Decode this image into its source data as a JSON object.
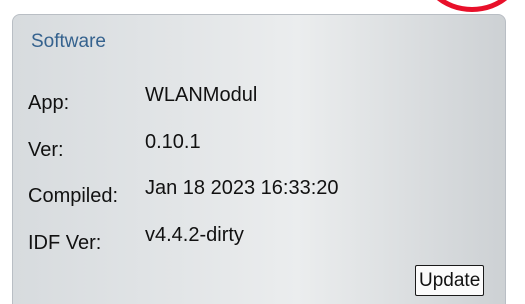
{
  "software": {
    "title": "Software",
    "rows": [
      {
        "label": "App:",
        "value": "WLANModul"
      },
      {
        "label": "Ver:",
        "value": "0.10.1"
      },
      {
        "label": "Compiled:",
        "value": "Jan 18 2023 16:33:20"
      },
      {
        "label": "IDF Ver:",
        "value": "v4.4.2-dirty"
      }
    ],
    "update_label": "Update"
  },
  "colors": {
    "title": "#35628e",
    "highlight_circle": "#e8102a"
  }
}
